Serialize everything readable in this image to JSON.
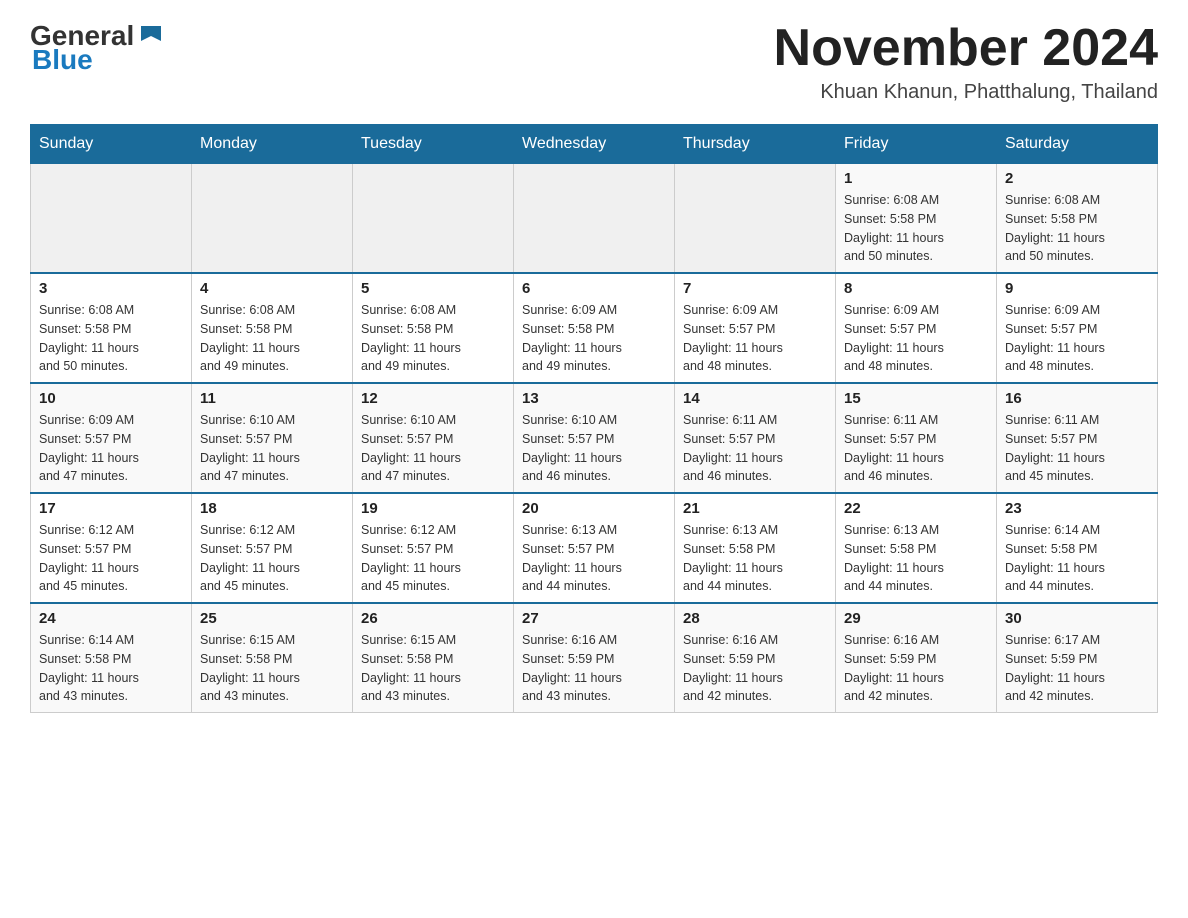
{
  "header": {
    "logo_general": "General",
    "logo_blue": "Blue",
    "month_title": "November 2024",
    "location": "Khuan Khanun, Phatthalung, Thailand"
  },
  "days_of_week": [
    "Sunday",
    "Monday",
    "Tuesday",
    "Wednesday",
    "Thursday",
    "Friday",
    "Saturday"
  ],
  "weeks": [
    [
      {
        "day": "",
        "info": ""
      },
      {
        "day": "",
        "info": ""
      },
      {
        "day": "",
        "info": ""
      },
      {
        "day": "",
        "info": ""
      },
      {
        "day": "",
        "info": ""
      },
      {
        "day": "1",
        "info": "Sunrise: 6:08 AM\nSunset: 5:58 PM\nDaylight: 11 hours\nand 50 minutes."
      },
      {
        "day": "2",
        "info": "Sunrise: 6:08 AM\nSunset: 5:58 PM\nDaylight: 11 hours\nand 50 minutes."
      }
    ],
    [
      {
        "day": "3",
        "info": "Sunrise: 6:08 AM\nSunset: 5:58 PM\nDaylight: 11 hours\nand 50 minutes."
      },
      {
        "day": "4",
        "info": "Sunrise: 6:08 AM\nSunset: 5:58 PM\nDaylight: 11 hours\nand 49 minutes."
      },
      {
        "day": "5",
        "info": "Sunrise: 6:08 AM\nSunset: 5:58 PM\nDaylight: 11 hours\nand 49 minutes."
      },
      {
        "day": "6",
        "info": "Sunrise: 6:09 AM\nSunset: 5:58 PM\nDaylight: 11 hours\nand 49 minutes."
      },
      {
        "day": "7",
        "info": "Sunrise: 6:09 AM\nSunset: 5:57 PM\nDaylight: 11 hours\nand 48 minutes."
      },
      {
        "day": "8",
        "info": "Sunrise: 6:09 AM\nSunset: 5:57 PM\nDaylight: 11 hours\nand 48 minutes."
      },
      {
        "day": "9",
        "info": "Sunrise: 6:09 AM\nSunset: 5:57 PM\nDaylight: 11 hours\nand 48 minutes."
      }
    ],
    [
      {
        "day": "10",
        "info": "Sunrise: 6:09 AM\nSunset: 5:57 PM\nDaylight: 11 hours\nand 47 minutes."
      },
      {
        "day": "11",
        "info": "Sunrise: 6:10 AM\nSunset: 5:57 PM\nDaylight: 11 hours\nand 47 minutes."
      },
      {
        "day": "12",
        "info": "Sunrise: 6:10 AM\nSunset: 5:57 PM\nDaylight: 11 hours\nand 47 minutes."
      },
      {
        "day": "13",
        "info": "Sunrise: 6:10 AM\nSunset: 5:57 PM\nDaylight: 11 hours\nand 46 minutes."
      },
      {
        "day": "14",
        "info": "Sunrise: 6:11 AM\nSunset: 5:57 PM\nDaylight: 11 hours\nand 46 minutes."
      },
      {
        "day": "15",
        "info": "Sunrise: 6:11 AM\nSunset: 5:57 PM\nDaylight: 11 hours\nand 46 minutes."
      },
      {
        "day": "16",
        "info": "Sunrise: 6:11 AM\nSunset: 5:57 PM\nDaylight: 11 hours\nand 45 minutes."
      }
    ],
    [
      {
        "day": "17",
        "info": "Sunrise: 6:12 AM\nSunset: 5:57 PM\nDaylight: 11 hours\nand 45 minutes."
      },
      {
        "day": "18",
        "info": "Sunrise: 6:12 AM\nSunset: 5:57 PM\nDaylight: 11 hours\nand 45 minutes."
      },
      {
        "day": "19",
        "info": "Sunrise: 6:12 AM\nSunset: 5:57 PM\nDaylight: 11 hours\nand 45 minutes."
      },
      {
        "day": "20",
        "info": "Sunrise: 6:13 AM\nSunset: 5:57 PM\nDaylight: 11 hours\nand 44 minutes."
      },
      {
        "day": "21",
        "info": "Sunrise: 6:13 AM\nSunset: 5:58 PM\nDaylight: 11 hours\nand 44 minutes."
      },
      {
        "day": "22",
        "info": "Sunrise: 6:13 AM\nSunset: 5:58 PM\nDaylight: 11 hours\nand 44 minutes."
      },
      {
        "day": "23",
        "info": "Sunrise: 6:14 AM\nSunset: 5:58 PM\nDaylight: 11 hours\nand 44 minutes."
      }
    ],
    [
      {
        "day": "24",
        "info": "Sunrise: 6:14 AM\nSunset: 5:58 PM\nDaylight: 11 hours\nand 43 minutes."
      },
      {
        "day": "25",
        "info": "Sunrise: 6:15 AM\nSunset: 5:58 PM\nDaylight: 11 hours\nand 43 minutes."
      },
      {
        "day": "26",
        "info": "Sunrise: 6:15 AM\nSunset: 5:58 PM\nDaylight: 11 hours\nand 43 minutes."
      },
      {
        "day": "27",
        "info": "Sunrise: 6:16 AM\nSunset: 5:59 PM\nDaylight: 11 hours\nand 43 minutes."
      },
      {
        "day": "28",
        "info": "Sunrise: 6:16 AM\nSunset: 5:59 PM\nDaylight: 11 hours\nand 42 minutes."
      },
      {
        "day": "29",
        "info": "Sunrise: 6:16 AM\nSunset: 5:59 PM\nDaylight: 11 hours\nand 42 minutes."
      },
      {
        "day": "30",
        "info": "Sunrise: 6:17 AM\nSunset: 5:59 PM\nDaylight: 11 hours\nand 42 minutes."
      }
    ]
  ]
}
